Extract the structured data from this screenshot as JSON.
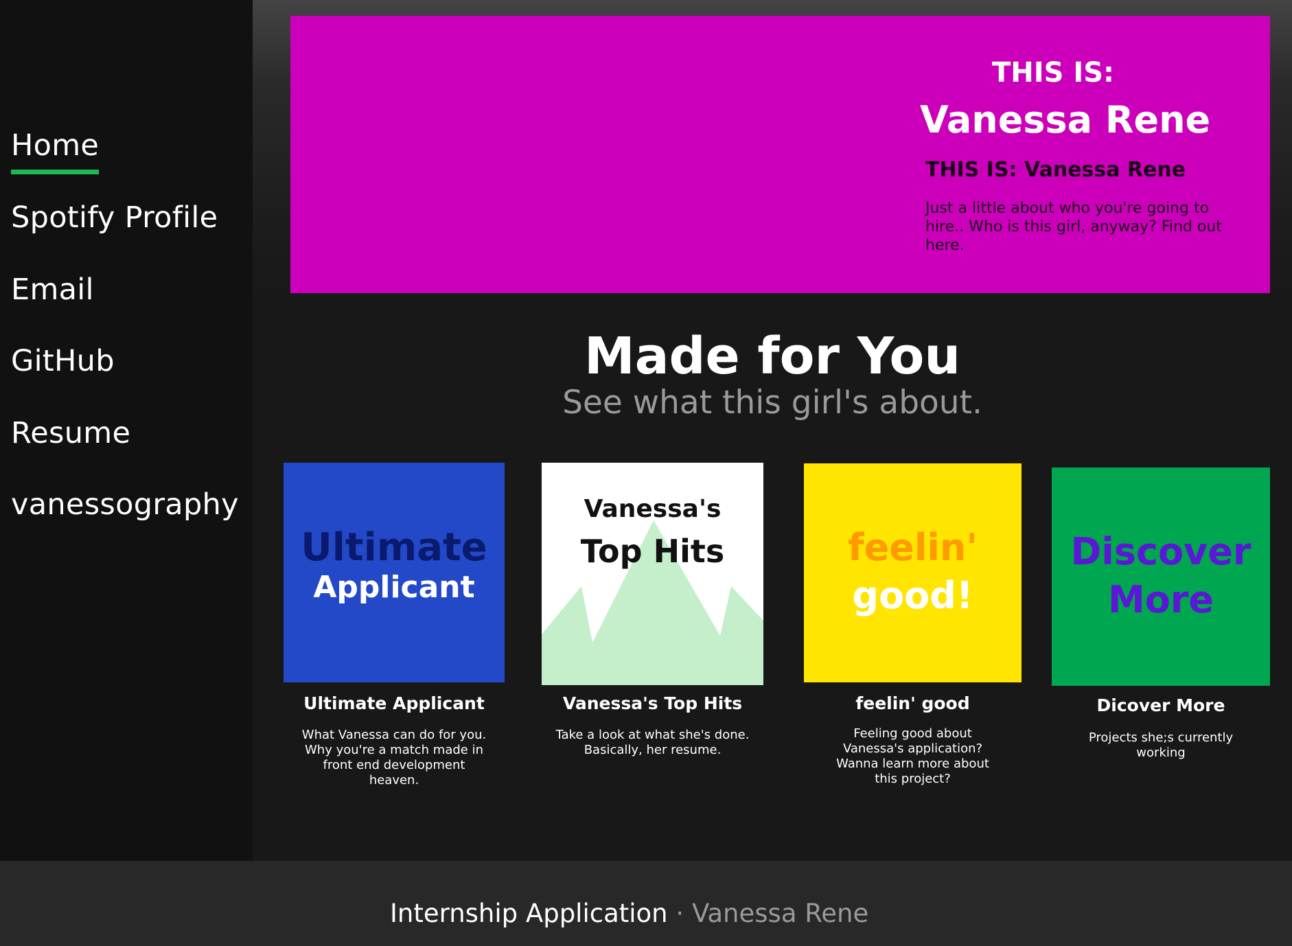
{
  "nav": {
    "items": [
      {
        "label": "Home",
        "active": true
      },
      {
        "label": "Spotify Profile"
      },
      {
        "label": "Email"
      },
      {
        "label": "GitHub"
      },
      {
        "label": "Resume"
      },
      {
        "label": "vanessography"
      }
    ]
  },
  "hero": {
    "kicker": "THIS IS:",
    "name": "Vanessa Rene",
    "subtitle": "THIS IS: Vanessa Rene",
    "description": "Just a little about who you're going to hire.. Who is this girl, anyway? Find out here.",
    "background": "#cc00bb"
  },
  "section": {
    "title": "Made for You",
    "subtitle": "See what this girl's about."
  },
  "cards": [
    {
      "art_line1": "Ultimate",
      "art_line2": "Applicant",
      "title": "Ultimate Applicant",
      "description": "What Vanessa can do for you. Why you're a match made in front end development heaven.",
      "color": "#2349c8"
    },
    {
      "art_line1": "Vanessa's",
      "art_line2": "Top Hits",
      "title": "Vanessa's Top Hits",
      "description": "Take a look at what she's done. Basically, her resume.",
      "color": "#ffffff"
    },
    {
      "art_line1": "feelin'",
      "art_line2": "good!",
      "title": "feelin' good",
      "description": "Feeling good about Vanessa's application? Wanna learn more about this project?",
      "color": "#ffe500"
    },
    {
      "art_line1": "Discover",
      "art_line2": "More",
      "title": "Dicover More",
      "description": "Projects she;s currently working",
      "color": "#00a650"
    }
  ],
  "footer": {
    "title": "Internship Application",
    "separator": "·",
    "author": "Vanessa Rene"
  },
  "colors": {
    "accent": "#1db954",
    "sidebar": "#111111",
    "footer": "#282828"
  }
}
